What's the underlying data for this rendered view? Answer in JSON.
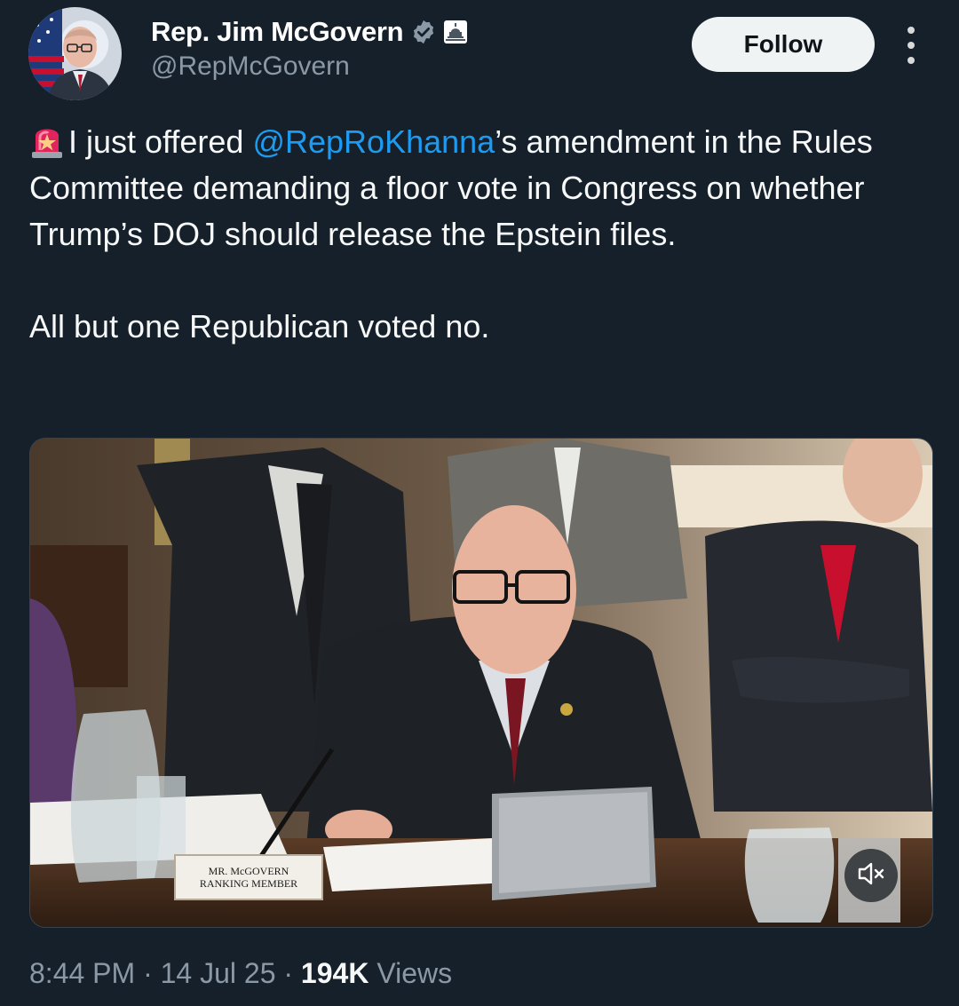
{
  "author": {
    "display_name": "Rep. Jim McGovern",
    "handle": "@RepMcGovern",
    "verified_icon": "verified-badge-icon",
    "affiliation_icon": "capitol-building-icon",
    "verified_color": "#8b98a5"
  },
  "actions": {
    "follow_label": "Follow",
    "more_icon": "more-options-icon"
  },
  "tweet": {
    "leading_icon": "siren-emoji-icon",
    "text_before_mention": "I just offered ",
    "mention": "@RepRoKhanna",
    "text_after_mention": "’s amendment in the Rules Committee demanding a floor vote in Congress on whether Trump’s DOJ should release the Epstein files.",
    "paragraph_2": "All but one Republican voted no."
  },
  "media": {
    "type": "video",
    "nameplate_line1": "MR. McGOVERN",
    "nameplate_line2": "RANKING MEMBER",
    "mute_icon": "speaker-muted-icon"
  },
  "meta": {
    "time": "8:44 PM",
    "separator": "·",
    "date": "14 Jul 25",
    "views_count": "194K",
    "views_label": "Views"
  },
  "colors": {
    "background": "#15202b",
    "text_primary": "#f7f9f9",
    "text_secondary": "#8b98a5",
    "link": "#1d9bf0",
    "follow_bg": "#eff3f4"
  }
}
